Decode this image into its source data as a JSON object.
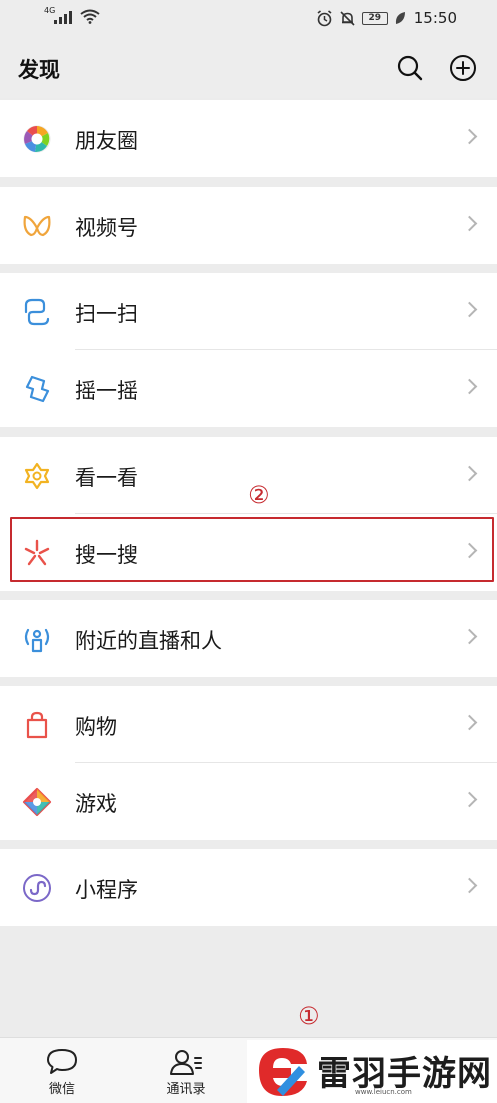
{
  "status_bar": {
    "network": "4G",
    "battery": "29",
    "time": "15:50"
  },
  "header": {
    "title": "发现",
    "search_icon": "search-icon",
    "add_icon": "plus-circle-icon"
  },
  "menu": {
    "moments": "朋友圈",
    "channels": "视频号",
    "scan": "扫一扫",
    "shake": "摇一摇",
    "top_stories": "看一看",
    "search": "搜一搜",
    "nearby": "附近的直播和人",
    "shopping": "购物",
    "games": "游戏",
    "mini_programs": "小程序"
  },
  "annotations": {
    "step1": "①",
    "step2": "②",
    "highlight_color": "#c62a2f"
  },
  "tabs": {
    "chats": "微信",
    "contacts": "通讯录"
  },
  "watermark": {
    "brand": "雷羽手游网",
    "url": "www.leiucn.com"
  }
}
